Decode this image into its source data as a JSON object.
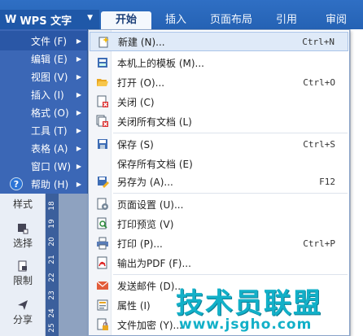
{
  "app": {
    "logo": "W",
    "title": "WPS 文字"
  },
  "ribbon": {
    "tabs": [
      "开始",
      "插入",
      "页面布局",
      "引用",
      "审阅"
    ]
  },
  "main_menu": {
    "items": [
      {
        "label": "文件 (F)"
      },
      {
        "label": "编辑 (E)"
      },
      {
        "label": "视图 (V)"
      },
      {
        "label": "插入 (I)"
      },
      {
        "label": "格式 (O)"
      },
      {
        "label": "工具 (T)"
      },
      {
        "label": "表格 (A)"
      },
      {
        "label": "窗口 (W)"
      },
      {
        "label": "帮助 (H)"
      }
    ]
  },
  "tools": [
    {
      "label": "样式"
    },
    {
      "label": "选择"
    },
    {
      "label": "限制"
    },
    {
      "label": "分享"
    }
  ],
  "ruler": [
    "18",
    "19",
    "20",
    "21",
    "22",
    "23",
    "24",
    "25"
  ],
  "file_menu": {
    "items": [
      {
        "label": "新建 (N)...",
        "shortcut": "Ctrl+N",
        "icon": "new-doc-icon"
      },
      {
        "label": "本机上的模板 (M)...",
        "shortcut": "",
        "icon": "template-icon"
      },
      {
        "label": "打开 (O)...",
        "shortcut": "Ctrl+O",
        "icon": "folder-open-icon"
      },
      {
        "label": "关闭 (C)",
        "shortcut": "",
        "icon": "close-doc-icon"
      },
      {
        "label": "关闭所有文档 (L)",
        "shortcut": "",
        "icon": "close-all-icon"
      },
      {
        "label": "保存 (S)",
        "shortcut": "Ctrl+S",
        "icon": "save-icon"
      },
      {
        "label": "保存所有文档 (E)",
        "shortcut": "",
        "icon": ""
      },
      {
        "label": "另存为 (A)...",
        "shortcut": "F12",
        "icon": "save-as-icon"
      },
      {
        "label": "页面设置 (U)...",
        "shortcut": "",
        "icon": "page-setup-icon"
      },
      {
        "label": "打印预览 (V)",
        "shortcut": "",
        "icon": "print-preview-icon"
      },
      {
        "label": "打印 (P)...",
        "shortcut": "Ctrl+P",
        "icon": "printer-icon"
      },
      {
        "label": "输出为PDF (F)...",
        "shortcut": "",
        "icon": "pdf-icon"
      },
      {
        "label": "发送邮件 (D)...",
        "shortcut": "",
        "icon": "mail-icon"
      },
      {
        "label": "属性 (I)",
        "shortcut": "",
        "icon": "properties-icon"
      },
      {
        "label": "文件加密 (Y)...",
        "shortcut": "",
        "icon": "lock-icon"
      }
    ]
  },
  "watermark": {
    "text": "技术员联盟",
    "url": "www.jsgho.com"
  }
}
